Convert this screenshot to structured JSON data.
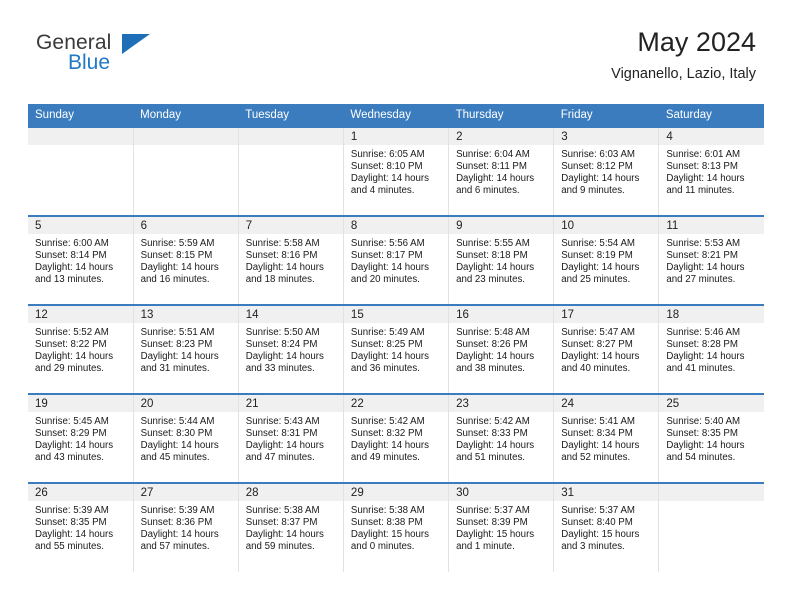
{
  "logo": {
    "primary_text": "General",
    "secondary_text": "Blue",
    "triangle_color": "#1f6fb8",
    "primary_color": "#3a3a3a",
    "secondary_color": "#2079c7"
  },
  "header": {
    "title": "May 2024",
    "location": "Vignanello, Lazio, Italy"
  },
  "theme": {
    "header_blue": "#3b7cbf",
    "daynum_bg": "#f0f0f0"
  },
  "weekdays": [
    "Sunday",
    "Monday",
    "Tuesday",
    "Wednesday",
    "Thursday",
    "Friday",
    "Saturday"
  ],
  "labels": {
    "sunrise_prefix": "Sunrise:",
    "sunset_prefix": "Sunset:",
    "daylight_prefix": "Daylight:"
  },
  "weeks": [
    [
      {
        "day": "",
        "empty": true
      },
      {
        "day": "",
        "empty": true
      },
      {
        "day": "",
        "empty": true
      },
      {
        "day": "1",
        "sunrise": "Sunrise: 6:05 AM",
        "sunset": "Sunset: 8:10 PM",
        "daylight": "Daylight: 14 hours and 4 minutes."
      },
      {
        "day": "2",
        "sunrise": "Sunrise: 6:04 AM",
        "sunset": "Sunset: 8:11 PM",
        "daylight": "Daylight: 14 hours and 6 minutes."
      },
      {
        "day": "3",
        "sunrise": "Sunrise: 6:03 AM",
        "sunset": "Sunset: 8:12 PM",
        "daylight": "Daylight: 14 hours and 9 minutes."
      },
      {
        "day": "4",
        "sunrise": "Sunrise: 6:01 AM",
        "sunset": "Sunset: 8:13 PM",
        "daylight": "Daylight: 14 hours and 11 minutes."
      }
    ],
    [
      {
        "day": "5",
        "sunrise": "Sunrise: 6:00 AM",
        "sunset": "Sunset: 8:14 PM",
        "daylight": "Daylight: 14 hours and 13 minutes."
      },
      {
        "day": "6",
        "sunrise": "Sunrise: 5:59 AM",
        "sunset": "Sunset: 8:15 PM",
        "daylight": "Daylight: 14 hours and 16 minutes."
      },
      {
        "day": "7",
        "sunrise": "Sunrise: 5:58 AM",
        "sunset": "Sunset: 8:16 PM",
        "daylight": "Daylight: 14 hours and 18 minutes."
      },
      {
        "day": "8",
        "sunrise": "Sunrise: 5:56 AM",
        "sunset": "Sunset: 8:17 PM",
        "daylight": "Daylight: 14 hours and 20 minutes."
      },
      {
        "day": "9",
        "sunrise": "Sunrise: 5:55 AM",
        "sunset": "Sunset: 8:18 PM",
        "daylight": "Daylight: 14 hours and 23 minutes."
      },
      {
        "day": "10",
        "sunrise": "Sunrise: 5:54 AM",
        "sunset": "Sunset: 8:19 PM",
        "daylight": "Daylight: 14 hours and 25 minutes."
      },
      {
        "day": "11",
        "sunrise": "Sunrise: 5:53 AM",
        "sunset": "Sunset: 8:21 PM",
        "daylight": "Daylight: 14 hours and 27 minutes."
      }
    ],
    [
      {
        "day": "12",
        "sunrise": "Sunrise: 5:52 AM",
        "sunset": "Sunset: 8:22 PM",
        "daylight": "Daylight: 14 hours and 29 minutes."
      },
      {
        "day": "13",
        "sunrise": "Sunrise: 5:51 AM",
        "sunset": "Sunset: 8:23 PM",
        "daylight": "Daylight: 14 hours and 31 minutes."
      },
      {
        "day": "14",
        "sunrise": "Sunrise: 5:50 AM",
        "sunset": "Sunset: 8:24 PM",
        "daylight": "Daylight: 14 hours and 33 minutes."
      },
      {
        "day": "15",
        "sunrise": "Sunrise: 5:49 AM",
        "sunset": "Sunset: 8:25 PM",
        "daylight": "Daylight: 14 hours and 36 minutes."
      },
      {
        "day": "16",
        "sunrise": "Sunrise: 5:48 AM",
        "sunset": "Sunset: 8:26 PM",
        "daylight": "Daylight: 14 hours and 38 minutes."
      },
      {
        "day": "17",
        "sunrise": "Sunrise: 5:47 AM",
        "sunset": "Sunset: 8:27 PM",
        "daylight": "Daylight: 14 hours and 40 minutes."
      },
      {
        "day": "18",
        "sunrise": "Sunrise: 5:46 AM",
        "sunset": "Sunset: 8:28 PM",
        "daylight": "Daylight: 14 hours and 41 minutes."
      }
    ],
    [
      {
        "day": "19",
        "sunrise": "Sunrise: 5:45 AM",
        "sunset": "Sunset: 8:29 PM",
        "daylight": "Daylight: 14 hours and 43 minutes."
      },
      {
        "day": "20",
        "sunrise": "Sunrise: 5:44 AM",
        "sunset": "Sunset: 8:30 PM",
        "daylight": "Daylight: 14 hours and 45 minutes."
      },
      {
        "day": "21",
        "sunrise": "Sunrise: 5:43 AM",
        "sunset": "Sunset: 8:31 PM",
        "daylight": "Daylight: 14 hours and 47 minutes."
      },
      {
        "day": "22",
        "sunrise": "Sunrise: 5:42 AM",
        "sunset": "Sunset: 8:32 PM",
        "daylight": "Daylight: 14 hours and 49 minutes."
      },
      {
        "day": "23",
        "sunrise": "Sunrise: 5:42 AM",
        "sunset": "Sunset: 8:33 PM",
        "daylight": "Daylight: 14 hours and 51 minutes."
      },
      {
        "day": "24",
        "sunrise": "Sunrise: 5:41 AM",
        "sunset": "Sunset: 8:34 PM",
        "daylight": "Daylight: 14 hours and 52 minutes."
      },
      {
        "day": "25",
        "sunrise": "Sunrise: 5:40 AM",
        "sunset": "Sunset: 8:35 PM",
        "daylight": "Daylight: 14 hours and 54 minutes."
      }
    ],
    [
      {
        "day": "26",
        "sunrise": "Sunrise: 5:39 AM",
        "sunset": "Sunset: 8:35 PM",
        "daylight": "Daylight: 14 hours and 55 minutes."
      },
      {
        "day": "27",
        "sunrise": "Sunrise: 5:39 AM",
        "sunset": "Sunset: 8:36 PM",
        "daylight": "Daylight: 14 hours and 57 minutes."
      },
      {
        "day": "28",
        "sunrise": "Sunrise: 5:38 AM",
        "sunset": "Sunset: 8:37 PM",
        "daylight": "Daylight: 14 hours and 59 minutes."
      },
      {
        "day": "29",
        "sunrise": "Sunrise: 5:38 AM",
        "sunset": "Sunset: 8:38 PM",
        "daylight": "Daylight: 15 hours and 0 minutes."
      },
      {
        "day": "30",
        "sunrise": "Sunrise: 5:37 AM",
        "sunset": "Sunset: 8:39 PM",
        "daylight": "Daylight: 15 hours and 1 minute."
      },
      {
        "day": "31",
        "sunrise": "Sunrise: 5:37 AM",
        "sunset": "Sunset: 8:40 PM",
        "daylight": "Daylight: 15 hours and 3 minutes."
      },
      {
        "day": "",
        "empty": true
      }
    ]
  ]
}
